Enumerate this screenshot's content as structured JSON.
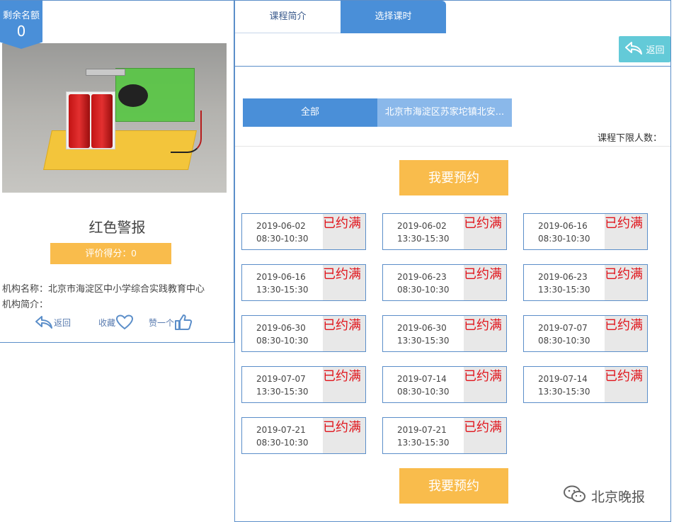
{
  "quota": {
    "label": "剩余名额",
    "value": "0"
  },
  "course": {
    "title": "红色警报",
    "rating_label": "评价得分：0"
  },
  "organization": {
    "name_line": "机构名称：北京市海淀区中小学综合实践教育中心",
    "intro_line": "机构简介："
  },
  "left_actions": {
    "back": "返回",
    "favorite": "收藏",
    "like": "赞一个"
  },
  "tabs": [
    {
      "label": "课程简介"
    },
    {
      "label": "选择课时"
    }
  ],
  "back_button": "返回",
  "filters": [
    {
      "label": "全部"
    },
    {
      "label": "北京市海淀区苏家坨镇北安..."
    }
  ],
  "min_count_label": "课程下限人数：",
  "book_button": "我要预约",
  "full_label": "已约满",
  "slots": [
    {
      "date": "2019-06-02",
      "time": "08:30-10:30"
    },
    {
      "date": "2019-06-02",
      "time": "13:30-15:30"
    },
    {
      "date": "2019-06-16",
      "time": "08:30-10:30"
    },
    {
      "date": "2019-06-16",
      "time": "13:30-15:30"
    },
    {
      "date": "2019-06-23",
      "time": "08:30-10:30"
    },
    {
      "date": "2019-06-23",
      "time": "13:30-15:30"
    },
    {
      "date": "2019-06-30",
      "time": "08:30-10:30"
    },
    {
      "date": "2019-06-30",
      "time": "13:30-15:30"
    },
    {
      "date": "2019-07-07",
      "time": "08:30-10:30"
    },
    {
      "date": "2019-07-07",
      "time": "13:30-15:30"
    },
    {
      "date": "2019-07-14",
      "time": "08:30-10:30"
    },
    {
      "date": "2019-07-14",
      "time": "13:30-15:30"
    },
    {
      "date": "2019-07-21",
      "time": "08:30-10:30"
    },
    {
      "date": "2019-07-21",
      "time": "13:30-15:30"
    }
  ],
  "watermark": "北京晚报",
  "colors": {
    "primary_blue": "#4a8fd8",
    "light_blue": "#8ab8ea",
    "accent_orange": "#f9bc4c",
    "full_red": "#e0141b",
    "back_teal": "#63cad8"
  },
  "icons": {
    "back": "back-arrow-icon",
    "favorite": "heart-icon",
    "like": "thumbs-up-icon",
    "watermark": "wechat-logo-icon"
  }
}
